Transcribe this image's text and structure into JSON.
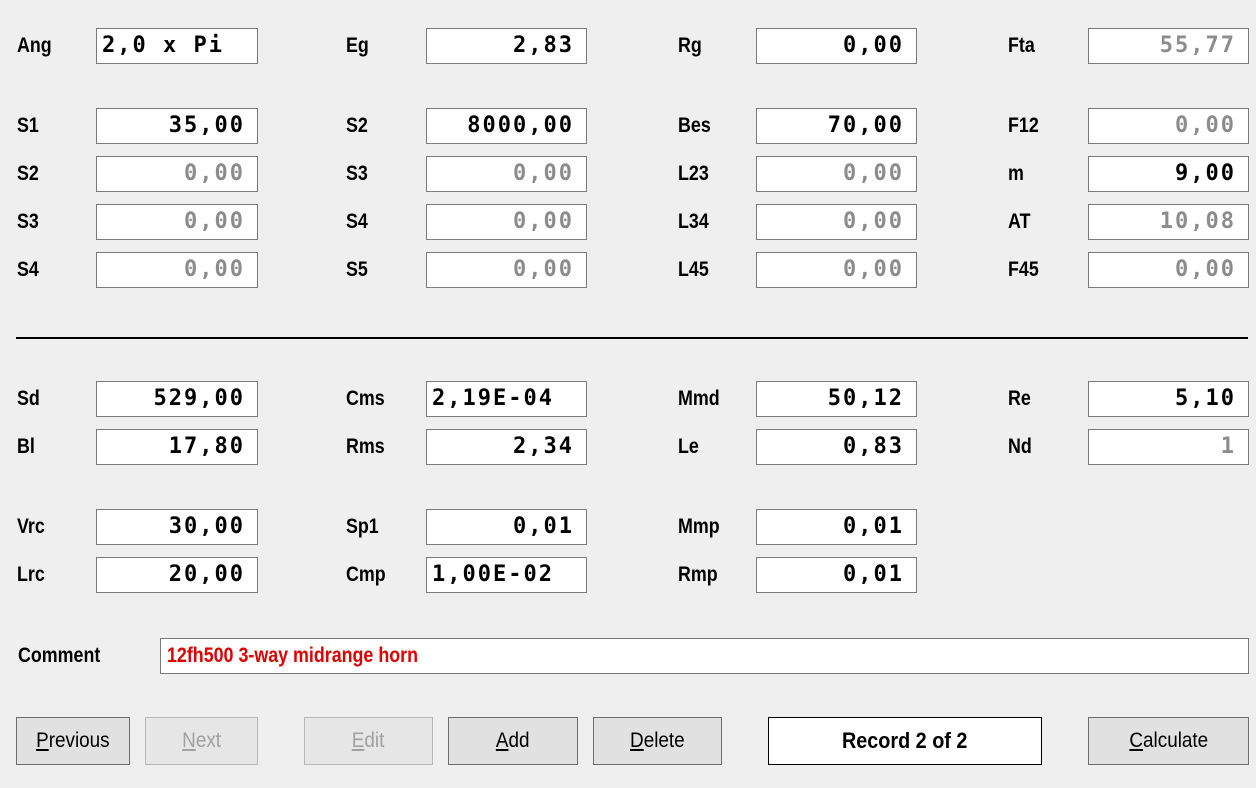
{
  "rows": [
    {
      "items": [
        {
          "label": "Ang",
          "value": "2,0 x Pi"
        },
        {
          "label": "Eg",
          "value": "2,83"
        },
        {
          "label": "Rg",
          "value": "0,00"
        },
        {
          "label": "Fta",
          "value": "55,77"
        }
      ]
    },
    {
      "items": [
        {
          "label": "S1",
          "value": "35,00"
        },
        {
          "label": "S2",
          "value": "8000,00"
        },
        {
          "label": "Bes",
          "value": "70,00"
        },
        {
          "label": "F12",
          "value": "0,00"
        }
      ]
    },
    {
      "items": [
        {
          "label": "S2",
          "value": "0,00"
        },
        {
          "label": "S3",
          "value": "0,00"
        },
        {
          "label": "L23",
          "value": "0,00"
        },
        {
          "label": "m",
          "value": "9,00"
        }
      ]
    },
    {
      "items": [
        {
          "label": "S3",
          "value": "0,00"
        },
        {
          "label": "S4",
          "value": "0,00"
        },
        {
          "label": "L34",
          "value": "0,00"
        },
        {
          "label": "AT",
          "value": "10,08"
        }
      ]
    },
    {
      "items": [
        {
          "label": "S4",
          "value": "0,00"
        },
        {
          "label": "S5",
          "value": "0,00"
        },
        {
          "label": "L45",
          "value": "0,00"
        },
        {
          "label": "F45",
          "value": "0,00"
        }
      ]
    },
    {
      "items": [
        {
          "label": "Sd",
          "value": "529,00"
        },
        {
          "label": "Cms",
          "value": "2,19E-04"
        },
        {
          "label": "Mmd",
          "value": "50,12"
        },
        {
          "label": "Re",
          "value": "5,10"
        }
      ]
    },
    {
      "items": [
        {
          "label": "Bl",
          "value": "17,80"
        },
        {
          "label": "Rms",
          "value": "2,34"
        },
        {
          "label": "Le",
          "value": "0,83"
        },
        {
          "label": "Nd",
          "value": "1"
        }
      ]
    },
    {
      "items": [
        {
          "label": "Vrc",
          "value": "30,00"
        },
        {
          "label": "Sp1",
          "value": "0,01"
        },
        {
          "label": "Mmp",
          "value": "0,01"
        }
      ]
    },
    {
      "items": [
        {
          "label": "Lrc",
          "value": "20,00"
        },
        {
          "label": "Cmp",
          "value": "1,00E-02"
        },
        {
          "label": "Rmp",
          "value": "0,01"
        }
      ]
    }
  ],
  "comment": {
    "label": "Comment",
    "value": "12fh500 3-way midrange horn",
    "text_color": "#e00000"
  },
  "buttons": {
    "previous": {
      "first": "P",
      "rest": "revious"
    },
    "next": {
      "first": "N",
      "rest": "ext"
    },
    "edit": {
      "first": "E",
      "rest": "dit"
    },
    "add": {
      "first": "A",
      "rest": "dd"
    },
    "delete": {
      "first": "D",
      "rest": "elete"
    },
    "calculate": {
      "first": "C",
      "rest": "alculate"
    }
  },
  "record_status": "Record 2 of 2"
}
